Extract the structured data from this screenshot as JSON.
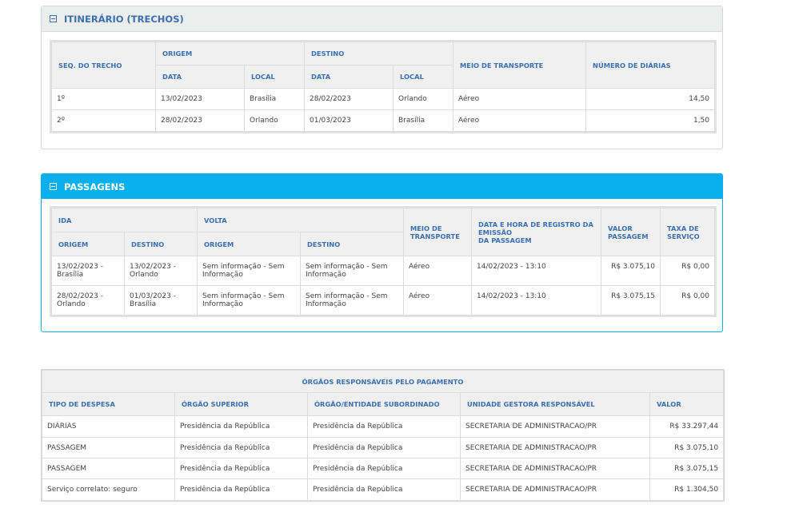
{
  "itinerario": {
    "title": "ITINERÁRIO (TRECHOS)",
    "headers": {
      "seq": "SEQ. DO TRECHO",
      "origem": "ORIGEM",
      "destino": "DESTINO",
      "data": "DATA",
      "local": "LOCAL",
      "meio": "MEIO DE TRANSPORTE",
      "diarias": "NÚMERO DE DIÁRIAS"
    },
    "rows": [
      {
        "seq": "1º",
        "orig_data": "13/02/2023",
        "orig_local": "Brasília",
        "dest_data": "28/02/2023",
        "dest_local": "Orlando",
        "meio": "Aéreo",
        "diarias": "14,50"
      },
      {
        "seq": "2º",
        "orig_data": "28/02/2023",
        "orig_local": "Orlando",
        "dest_data": "01/03/2023",
        "dest_local": "Brasília",
        "meio": "Aéreo",
        "diarias": "1,50"
      }
    ]
  },
  "passagens": {
    "title": "PASSAGENS",
    "headers": {
      "ida": "IDA",
      "volta": "VOLTA",
      "origem": "ORIGEM",
      "destino": "DESTINO",
      "meio_l1": "MEIO DE",
      "meio_l2": "TRANSPORTE",
      "registro_l1": "DATA E HORA DE REGISTRO DA EMISSÃO",
      "registro_l2": "DA PASSAGEM",
      "valor_l1": "VALOR",
      "valor_l2": "PASSAGEM",
      "taxa_l1": "TAXA DE",
      "taxa_l2": "SERVIÇO"
    },
    "rows": [
      {
        "ida_orig": "13/02/2023 -\nBrasília",
        "ida_dest": "13/02/2023 -\nOrlando",
        "volta_orig": "Sem informação - Sem\nInformação",
        "volta_dest": "Sem informação - Sem\nInformação",
        "meio": "Aéreo",
        "registro": "14/02/2023 - 13:10",
        "valor": "R$ 3.075,10",
        "taxa": "R$ 0,00"
      },
      {
        "ida_orig": "28/02/2023 -\nOrlando",
        "ida_dest": "01/03/2023 -\nBrasília",
        "volta_orig": "Sem informação - Sem\nInformação",
        "volta_dest": "Sem informação - Sem\nInformação",
        "meio": "Aéreo",
        "registro": "14/02/2023 - 13:10",
        "valor": "R$ 3.075,15",
        "taxa": "R$ 0,00"
      }
    ]
  },
  "orgaos": {
    "title": "ÓRGÃOS RESPONSÁVEIS PELO PAGAMENTO",
    "headers": {
      "tipo": "TIPO DE DESPESA",
      "superior": "ÓRGÃO SUPERIOR",
      "subordinado": "ÓRGÃO/ENTIDADE SUBORDINADO",
      "unidade": "UNIDADE GESTORA RESPONSÁVEL",
      "valor": "VALOR"
    },
    "rows": [
      {
        "tipo": "DIÁRIAS",
        "superior": "Presidência da República",
        "subordinado": "Presidência da República",
        "unidade": "SECRETARIA DE ADMINISTRACAO/PR",
        "valor": "R$ 33.297,44"
      },
      {
        "tipo": "PASSAGEM",
        "superior": "Presidência da República",
        "subordinado": "Presidência da República",
        "unidade": "SECRETARIA DE ADMINISTRACAO/PR",
        "valor": "R$ 3.075,10"
      },
      {
        "tipo": "PASSAGEM",
        "superior": "Presidência da República",
        "subordinado": "Presidência da República",
        "unidade": "SECRETARIA DE ADMINISTRACAO/PR",
        "valor": "R$ 3.075,15"
      },
      {
        "tipo": "Serviço correlato: seguro",
        "superior": "Presidência da República",
        "subordinado": "Presidência da República",
        "unidade": "SECRETARIA DE ADMINISTRACAO/PR",
        "valor": "R$ 1.304,50"
      }
    ]
  },
  "colors": {
    "accent_blue": "#09aeed",
    "header_text": "#3b6fb0",
    "grey_header": "#eceded"
  },
  "icons": {
    "collapse": "minus-square-icon"
  }
}
